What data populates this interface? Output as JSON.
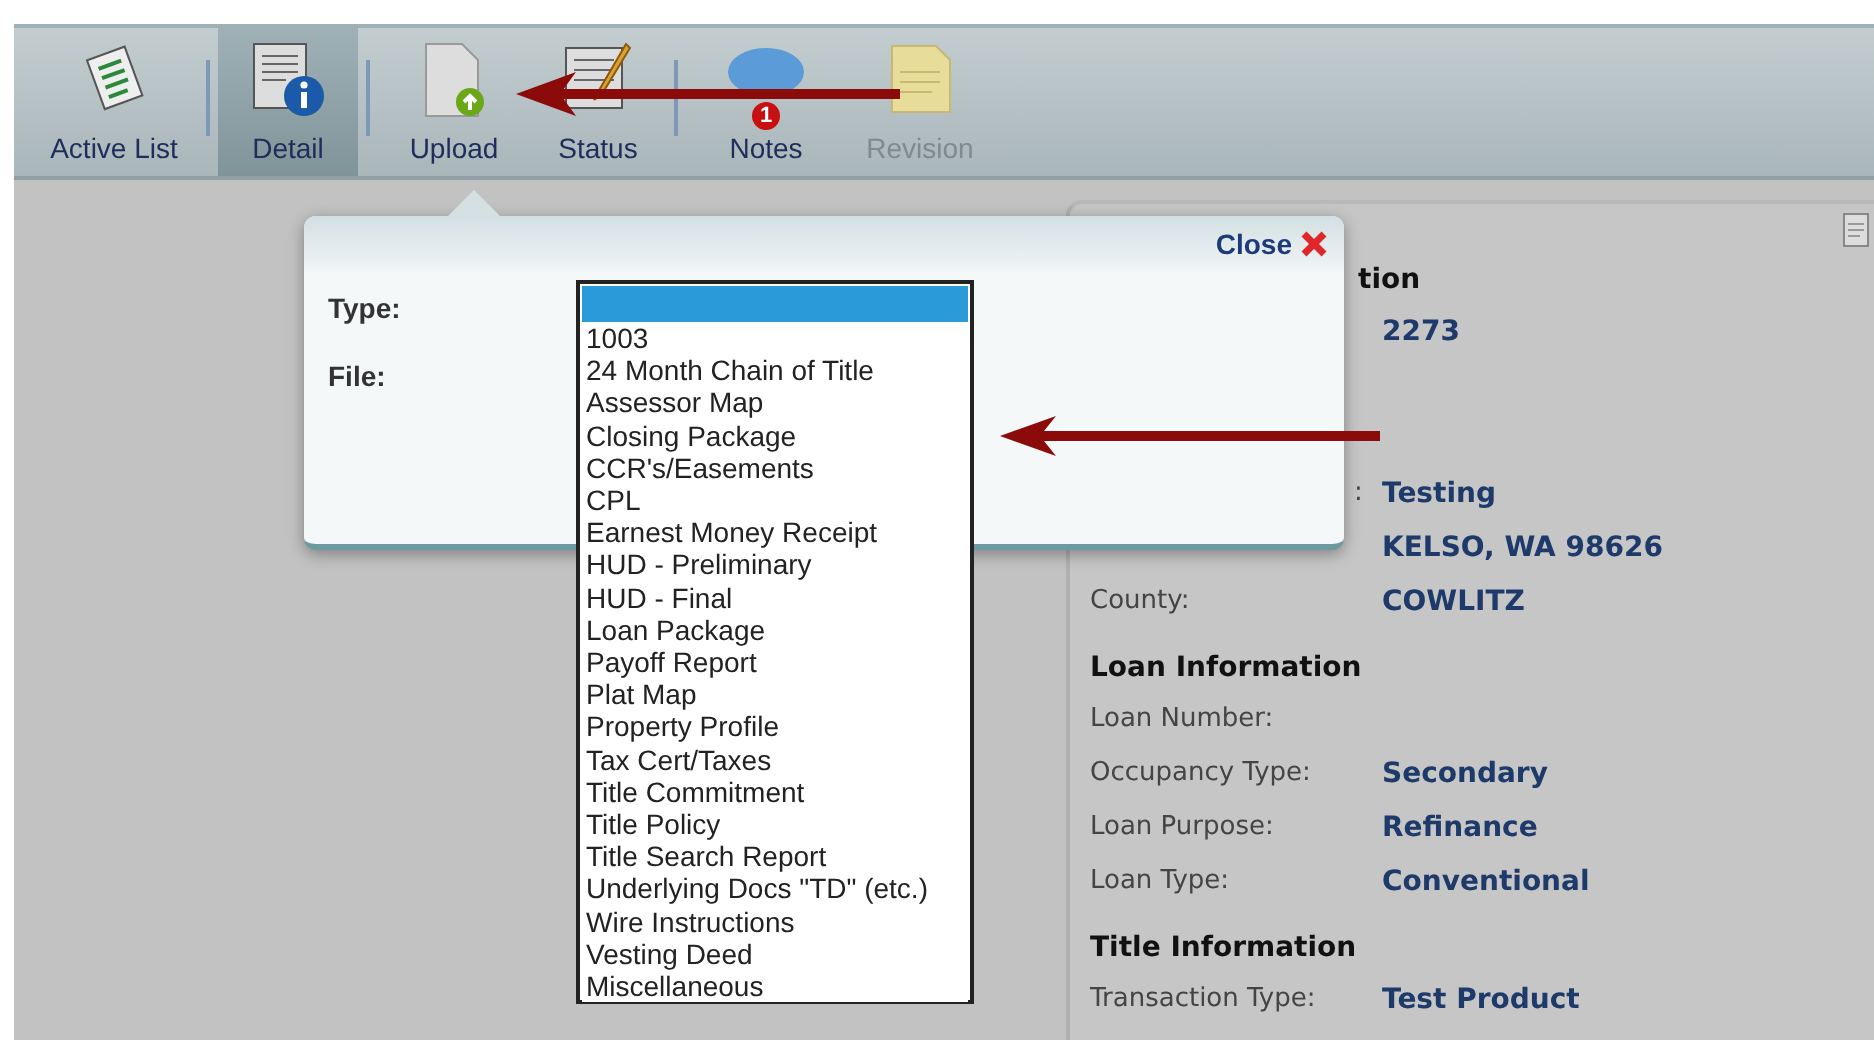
{
  "toolbar": {
    "items": [
      {
        "label": "Active List",
        "selected": false,
        "disabled": false
      },
      {
        "label": "Detail",
        "selected": true,
        "disabled": false
      },
      {
        "label": "Upload",
        "selected": false,
        "disabled": false
      },
      {
        "label": "Status",
        "selected": false,
        "disabled": false
      },
      {
        "label": "Notes",
        "selected": false,
        "disabled": false,
        "badge": "1"
      },
      {
        "label": "Revision",
        "selected": false,
        "disabled": true
      }
    ]
  },
  "upload_popup": {
    "close_label": "Close",
    "fields": [
      "Type:",
      "File:"
    ],
    "type_dropdown": {
      "blank_option_selected": true,
      "options": [
        {
          "label": "1003",
          "selected": false
        },
        {
          "label": "24 Month Chain of Title",
          "selected": false
        },
        {
          "label": "Assessor Map",
          "selected": false
        },
        {
          "label": "Closing Package",
          "selected": false
        },
        {
          "label": "CCR's/Easements",
          "selected": false
        },
        {
          "label": "CPL",
          "selected": false
        },
        {
          "label": "Earnest Money Receipt",
          "selected": false
        },
        {
          "label": "HUD - Preliminary",
          "selected": false
        },
        {
          "label": "HUD - Final",
          "selected": false
        },
        {
          "label": "Loan Package",
          "selected": false
        },
        {
          "label": "Payoff Report",
          "selected": false
        },
        {
          "label": "Plat Map",
          "selected": false
        },
        {
          "label": "Property Profile",
          "selected": false
        },
        {
          "label": "Tax Cert/Taxes",
          "selected": false
        },
        {
          "label": "Title Commitment",
          "selected": false
        },
        {
          "label": "Title Policy",
          "selected": false
        },
        {
          "label": "Title Search Report",
          "selected": false
        },
        {
          "label": "Underlying Docs \"TD\" (etc.)",
          "selected": false
        },
        {
          "label": "Wire Instructions",
          "selected": false
        },
        {
          "label": "Vesting Deed",
          "selected": false
        },
        {
          "label": "Miscellaneous",
          "selected": false
        }
      ]
    }
  },
  "details": {
    "sections": [
      {
        "heading": "tion",
        "heading_cut": true,
        "rows": [
          {
            "kind": "row",
            "value": "2273"
          },
          {
            "kind": "blank"
          },
          {
            "kind": "blank"
          },
          {
            "kind": "row_cut",
            "label": ":",
            "value": "Testing"
          },
          {
            "kind": "row",
            "value": "KELSO, WA 98626"
          },
          {
            "kind": "row",
            "label": "County:",
            "value": "COWLITZ"
          }
        ]
      },
      {
        "heading": "Loan Information",
        "rows": [
          {
            "kind": "row",
            "label": "Loan Number:"
          },
          {
            "kind": "row",
            "label": "Occupancy Type:",
            "value": "Secondary"
          },
          {
            "kind": "row",
            "label": "Loan Purpose:",
            "value": "Refinance"
          },
          {
            "kind": "row",
            "label": "Loan Type:",
            "value": "Conventional"
          }
        ]
      },
      {
        "heading": "Title Information",
        "rows": [
          {
            "kind": "row",
            "label": "Transaction Type:",
            "value": "Test Product"
          }
        ]
      }
    ]
  }
}
